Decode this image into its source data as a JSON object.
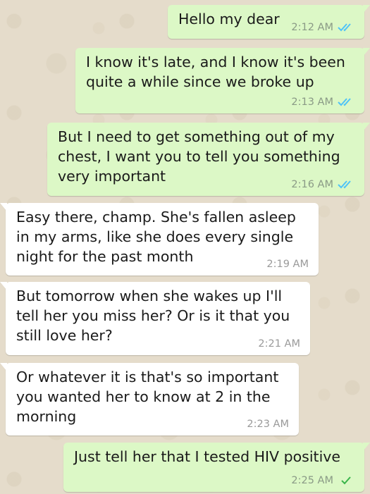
{
  "colors": {
    "outgoing_bubble": "#dcf8c6",
    "incoming_bubble": "#ffffff",
    "chat_background": "#e5dccb",
    "read_tick": "#4fc3f7"
  },
  "messages": [
    {
      "direction": "outgoing",
      "text": "Hello my dear",
      "time": "2:12 AM",
      "status": "read-double-check"
    },
    {
      "direction": "outgoing",
      "text": "I know it's late, and I know it's been\nquite a while since we broke up",
      "time": "2:13 AM",
      "status": "read-double-check"
    },
    {
      "direction": "outgoing",
      "text": "But I need to get something out of my\nchest, I want you to tell you something\nvery important",
      "time": "2:16 AM",
      "status": "read-double-check"
    },
    {
      "direction": "incoming",
      "text": "Easy there, champ. She's fallen asleep\nin my arms, like she does every single\nnight for the past month",
      "time": "2:19 AM"
    },
    {
      "direction": "incoming",
      "text": "But tomorrow when she wakes up I'll\ntell her you miss her? Or is it that you\nstill love her?",
      "time": "2:21 AM"
    },
    {
      "direction": "incoming",
      "text": "Or whatever it is that's so important\nyou wanted her to know at 2 in the\nmorning",
      "time": "2:23 AM"
    },
    {
      "direction": "outgoing",
      "text": "Just tell her that I tested HIV positive",
      "time": "2:25 AM",
      "status": "sent-single-check"
    }
  ]
}
